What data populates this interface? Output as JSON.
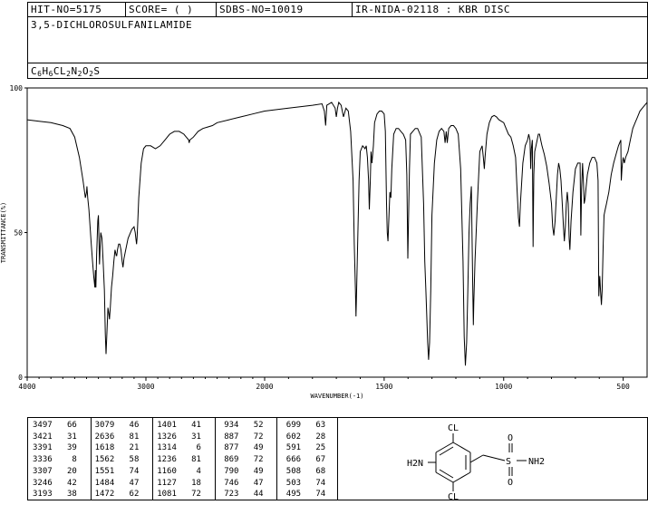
{
  "header": {
    "hit_no": "HIT-NO=5175",
    "score": "SCORE=  (    )",
    "sdbs_no": "SDBS-NO=10019",
    "ir_info": "IR-NIDA-02118 : KBR DISC"
  },
  "compound": {
    "name": "3,5-DICHLOROSULFANILAMIDE",
    "formula_parts": [
      {
        "t": "C",
        "sub": "6"
      },
      {
        "t": "H",
        "sub": "6"
      },
      {
        "t": "CL",
        "sub": "2"
      },
      {
        "t": "N",
        "sub": "2"
      },
      {
        "t": "O",
        "sub": "2"
      },
      {
        "t": "S",
        "sub": ""
      }
    ]
  },
  "chart_data": {
    "type": "line",
    "xlabel": "WAVENUMBER(-1)",
    "ylabel": "TRANSMITTANCE(%)",
    "xlim": [
      4000,
      400
    ],
    "ylim": [
      0,
      100
    ],
    "xticks": [
      4000,
      3000,
      2000,
      1500,
      1000,
      500
    ],
    "yticks": [
      0,
      50,
      100
    ],
    "grid": false,
    "series": [
      {
        "points": [
          [
            4000,
            89
          ],
          [
            3900,
            88.5
          ],
          [
            3800,
            88
          ],
          [
            3700,
            87
          ],
          [
            3640,
            86
          ],
          [
            3600,
            83
          ],
          [
            3560,
            76
          ],
          [
            3530,
            68
          ],
          [
            3510,
            62
          ],
          [
            3500,
            64
          ],
          [
            3497,
            66
          ],
          [
            3490,
            62
          ],
          [
            3480,
            58
          ],
          [
            3470,
            52
          ],
          [
            3460,
            46
          ],
          [
            3450,
            40
          ],
          [
            3440,
            35
          ],
          [
            3430,
            31
          ],
          [
            3425,
            37
          ],
          [
            3421,
            31
          ],
          [
            3415,
            42
          ],
          [
            3405,
            54
          ],
          [
            3400,
            56
          ],
          [
            3395,
            46
          ],
          [
            3391,
            39
          ],
          [
            3385,
            46
          ],
          [
            3380,
            50
          ],
          [
            3370,
            48
          ],
          [
            3360,
            40
          ],
          [
            3350,
            30
          ],
          [
            3342,
            15
          ],
          [
            3336,
            8
          ],
          [
            3330,
            14
          ],
          [
            3320,
            24
          ],
          [
            3312,
            22
          ],
          [
            3307,
            20
          ],
          [
            3300,
            24
          ],
          [
            3290,
            31
          ],
          [
            3280,
            35
          ],
          [
            3270,
            40
          ],
          [
            3260,
            44
          ],
          [
            3250,
            42
          ],
          [
            3246,
            42
          ],
          [
            3240,
            44
          ],
          [
            3230,
            46
          ],
          [
            3220,
            46
          ],
          [
            3210,
            44
          ],
          [
            3200,
            40
          ],
          [
            3193,
            38
          ],
          [
            3185,
            41
          ],
          [
            3170,
            44
          ],
          [
            3150,
            48
          ],
          [
            3120,
            51
          ],
          [
            3100,
            52
          ],
          [
            3090,
            50
          ],
          [
            3085,
            48
          ],
          [
            3079,
            46
          ],
          [
            3075,
            48
          ],
          [
            3070,
            52
          ],
          [
            3060,
            62
          ],
          [
            3040,
            74
          ],
          [
            3020,
            79
          ],
          [
            3000,
            80
          ],
          [
            2960,
            80
          ],
          [
            2920,
            79
          ],
          [
            2880,
            80
          ],
          [
            2840,
            82
          ],
          [
            2800,
            84
          ],
          [
            2760,
            85
          ],
          [
            2720,
            85
          ],
          [
            2680,
            84
          ],
          [
            2660,
            83
          ],
          [
            2640,
            82
          ],
          [
            2636,
            81
          ],
          [
            2630,
            82
          ],
          [
            2600,
            83
          ],
          [
            2560,
            85
          ],
          [
            2520,
            86
          ],
          [
            2480,
            86.5
          ],
          [
            2440,
            87
          ],
          [
            2400,
            88
          ],
          [
            2300,
            89
          ],
          [
            2200,
            90
          ],
          [
            2100,
            91
          ],
          [
            2000,
            92
          ],
          [
            1900,
            93
          ],
          [
            1800,
            94
          ],
          [
            1760,
            94.5
          ],
          [
            1750,
            92
          ],
          [
            1745,
            87
          ],
          [
            1740,
            94
          ],
          [
            1720,
            95
          ],
          [
            1705,
            93
          ],
          [
            1700,
            90
          ],
          [
            1695,
            93
          ],
          [
            1690,
            95
          ],
          [
            1680,
            94
          ],
          [
            1670,
            90
          ],
          [
            1660,
            93
          ],
          [
            1650,
            92
          ],
          [
            1640,
            85
          ],
          [
            1630,
            68
          ],
          [
            1625,
            46
          ],
          [
            1620,
            30
          ],
          [
            1618,
            21
          ],
          [
            1615,
            30
          ],
          [
            1610,
            50
          ],
          [
            1605,
            68
          ],
          [
            1600,
            78
          ],
          [
            1590,
            80
          ],
          [
            1580,
            79
          ],
          [
            1575,
            80
          ],
          [
            1570,
            76
          ],
          [
            1565,
            68
          ],
          [
            1562,
            58
          ],
          [
            1558,
            68
          ],
          [
            1555,
            78
          ],
          [
            1551,
            74
          ],
          [
            1545,
            80
          ],
          [
            1540,
            88
          ],
          [
            1530,
            91
          ],
          [
            1520,
            92
          ],
          [
            1510,
            92
          ],
          [
            1500,
            91
          ],
          [
            1495,
            85
          ],
          [
            1490,
            60
          ],
          [
            1487,
            50
          ],
          [
            1484,
            47
          ],
          [
            1480,
            55
          ],
          [
            1476,
            64
          ],
          [
            1472,
            62
          ],
          [
            1468,
            72
          ],
          [
            1460,
            84
          ],
          [
            1450,
            86
          ],
          [
            1440,
            86
          ],
          [
            1430,
            85
          ],
          [
            1420,
            84
          ],
          [
            1410,
            82
          ],
          [
            1405,
            70
          ],
          [
            1401,
            41
          ],
          [
            1398,
            55
          ],
          [
            1394,
            72
          ],
          [
            1390,
            84
          ],
          [
            1380,
            85
          ],
          [
            1370,
            86
          ],
          [
            1360,
            86
          ],
          [
            1345,
            83
          ],
          [
            1335,
            60
          ],
          [
            1330,
            40
          ],
          [
            1326,
            31
          ],
          [
            1322,
            22
          ],
          [
            1318,
            12
          ],
          [
            1314,
            6
          ],
          [
            1310,
            12
          ],
          [
            1305,
            30
          ],
          [
            1300,
            56
          ],
          [
            1290,
            74
          ],
          [
            1280,
            82
          ],
          [
            1270,
            85
          ],
          [
            1260,
            86
          ],
          [
            1250,
            85
          ],
          [
            1245,
            81
          ],
          [
            1240,
            85
          ],
          [
            1236,
            81
          ],
          [
            1230,
            86
          ],
          [
            1220,
            87
          ],
          [
            1210,
            87
          ],
          [
            1200,
            86
          ],
          [
            1190,
            84
          ],
          [
            1180,
            72
          ],
          [
            1170,
            40
          ],
          [
            1165,
            14
          ],
          [
            1160,
            4
          ],
          [
            1155,
            12
          ],
          [
            1150,
            30
          ],
          [
            1145,
            50
          ],
          [
            1140,
            60
          ],
          [
            1135,
            66
          ],
          [
            1130,
            34
          ],
          [
            1127,
            18
          ],
          [
            1125,
            26
          ],
          [
            1120,
            40
          ],
          [
            1110,
            60
          ],
          [
            1100,
            78
          ],
          [
            1090,
            80
          ],
          [
            1085,
            76
          ],
          [
            1081,
            72
          ],
          [
            1078,
            76
          ],
          [
            1070,
            84
          ],
          [
            1060,
            88
          ],
          [
            1050,
            90
          ],
          [
            1040,
            90.5
          ],
          [
            1030,
            90
          ],
          [
            1020,
            89
          ],
          [
            1000,
            88
          ],
          [
            990,
            86
          ],
          [
            980,
            84
          ],
          [
            970,
            83
          ],
          [
            960,
            80
          ],
          [
            950,
            76
          ],
          [
            944,
            65
          ],
          [
            938,
            55
          ],
          [
            934,
            52
          ],
          [
            930,
            60
          ],
          [
            920,
            74
          ],
          [
            910,
            80
          ],
          [
            900,
            82
          ],
          [
            895,
            84
          ],
          [
            890,
            82
          ],
          [
            887,
            72
          ],
          [
            884,
            79
          ],
          [
            880,
            82
          ],
          [
            877,
            45
          ],
          [
            874,
            70
          ],
          [
            870,
            78
          ],
          [
            865,
            80
          ],
          [
            860,
            82
          ],
          [
            855,
            84
          ],
          [
            850,
            84
          ],
          [
            845,
            82
          ],
          [
            840,
            80
          ],
          [
            830,
            77
          ],
          [
            820,
            73
          ],
          [
            810,
            67
          ],
          [
            800,
            60
          ],
          [
            795,
            52
          ],
          [
            790,
            49
          ],
          [
            785,
            54
          ],
          [
            780,
            62
          ],
          [
            775,
            70
          ],
          [
            770,
            74
          ],
          [
            765,
            72
          ],
          [
            760,
            68
          ],
          [
            755,
            60
          ],
          [
            750,
            52
          ],
          [
            746,
            47
          ],
          [
            742,
            52
          ],
          [
            738,
            60
          ],
          [
            734,
            64
          ],
          [
            730,
            60
          ],
          [
            726,
            48
          ],
          [
            723,
            44
          ],
          [
            718,
            54
          ],
          [
            710,
            64
          ],
          [
            700,
            72
          ],
          [
            690,
            74
          ],
          [
            680,
            74
          ],
          [
            677,
            49
          ],
          [
            674,
            65
          ],
          [
            670,
            74
          ],
          [
            666,
            67
          ],
          [
            663,
            60
          ],
          [
            659,
            62
          ],
          [
            656,
            65
          ],
          [
            650,
            70
          ],
          [
            640,
            74
          ],
          [
            630,
            76
          ],
          [
            620,
            76
          ],
          [
            610,
            74
          ],
          [
            605,
            68
          ],
          [
            602,
            28
          ],
          [
            598,
            35
          ],
          [
            595,
            30
          ],
          [
            591,
            25
          ],
          [
            588,
            30
          ],
          [
            584,
            45
          ],
          [
            580,
            56
          ],
          [
            575,
            58
          ],
          [
            570,
            60
          ],
          [
            565,
            62
          ],
          [
            560,
            64
          ],
          [
            555,
            67
          ],
          [
            550,
            70
          ],
          [
            540,
            74
          ],
          [
            530,
            77
          ],
          [
            520,
            80
          ],
          [
            510,
            82
          ],
          [
            508,
            68
          ],
          [
            505,
            72
          ],
          [
            503,
            74
          ],
          [
            500,
            76
          ],
          [
            495,
            74
          ],
          [
            490,
            76
          ],
          [
            480,
            78
          ],
          [
            470,
            82
          ],
          [
            460,
            86
          ],
          [
            450,
            88
          ],
          [
            440,
            90
          ],
          [
            430,
            92
          ],
          [
            420,
            93
          ],
          [
            410,
            94
          ],
          [
            400,
            95
          ]
        ]
      }
    ],
    "peak_table": [
      [
        [
          3497,
          66
        ],
        [
          3421,
          31
        ],
        [
          3391,
          39
        ],
        [
          3336,
          8
        ],
        [
          3307,
          20
        ],
        [
          3246,
          42
        ],
        [
          3193,
          38
        ]
      ],
      [
        [
          3079,
          46
        ],
        [
          2636,
          81
        ],
        [
          1618,
          21
        ],
        [
          1562,
          58
        ],
        [
          1551,
          74
        ],
        [
          1484,
          47
        ],
        [
          1472,
          62
        ]
      ],
      [
        [
          1401,
          41
        ],
        [
          1326,
          31
        ],
        [
          1314,
          6
        ],
        [
          1236,
          81
        ],
        [
          1160,
          4
        ],
        [
          1127,
          18
        ],
        [
          1081,
          72
        ]
      ],
      [
        [
          934,
          52
        ],
        [
          887,
          72
        ],
        [
          877,
          49
        ],
        [
          869,
          72
        ],
        [
          790,
          49
        ],
        [
          746,
          47
        ],
        [
          723,
          44
        ]
      ],
      [
        [
          699,
          63
        ],
        [
          602,
          28
        ],
        [
          591,
          25
        ],
        [
          666,
          67
        ],
        [
          508,
          68
        ],
        [
          503,
          74
        ],
        [
          495,
          74
        ]
      ]
    ]
  },
  "structure": {
    "atoms": [
      "CL",
      "H2N",
      "S",
      "O",
      "O",
      "NH2",
      "CL"
    ]
  }
}
